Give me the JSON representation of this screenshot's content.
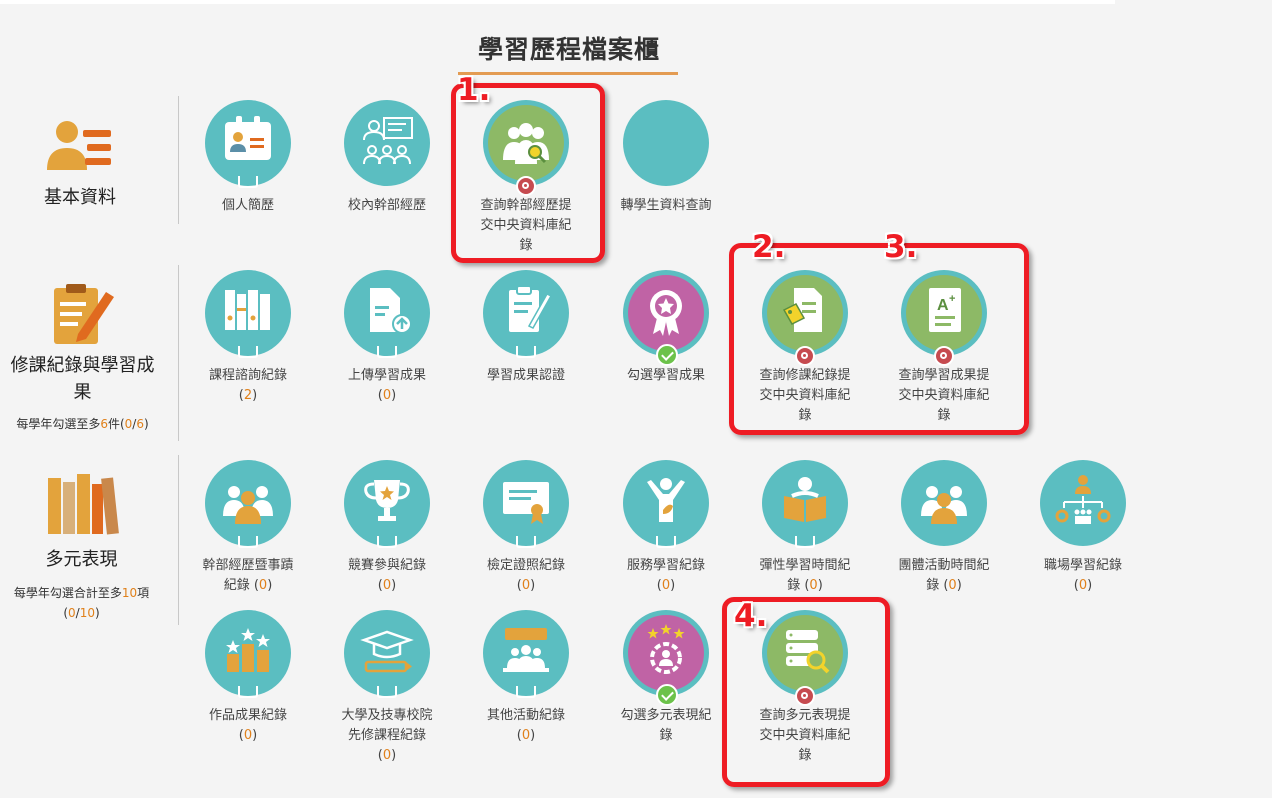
{
  "page": {
    "title": "學習歷程檔案櫃"
  },
  "categories": {
    "basic": {
      "label": "基本資料"
    },
    "course": {
      "label_line1": "修課紀錄與學習成",
      "label_line2": "果",
      "note_prefix": "每學年勾選至多",
      "note_max": "6",
      "note_mid": "件(",
      "note_cur": "0",
      "note_sep": "/",
      "note_max2": "6",
      "note_suffix": ")"
    },
    "multi": {
      "label": "多元表現",
      "note_prefix": "每學年勾選合計至多",
      "note_max": "10",
      "note_suffix": "項",
      "count_open": "(",
      "count_cur": "0",
      "count_sep": "/",
      "count_max": "10",
      "count_close": ")"
    }
  },
  "items": {
    "resume": {
      "label": "個人簡歷"
    },
    "cadre": {
      "label": "校內幹部經歷"
    },
    "cadre_central": {
      "label_l1": "查詢幹部經歷提",
      "label_l2": "交中央資料庫紀",
      "label_l3": "錄"
    },
    "transfer": {
      "label": "轉學生資料查詢"
    },
    "course_consult": {
      "label": "課程諮詢紀錄",
      "count": "2"
    },
    "upload_result": {
      "label": "上傳學習成果",
      "count": "0"
    },
    "result_cert": {
      "label": "學習成果認證"
    },
    "select_result": {
      "label": "勾選學習成果"
    },
    "course_central": {
      "label_l1": "查詢修課紀錄提",
      "label_l2": "交中央資料庫紀",
      "label_l3": "錄"
    },
    "result_central": {
      "label_l1": "查詢學習成果提",
      "label_l2": "交中央資料庫紀",
      "label_l3": "錄"
    },
    "cadre_record": {
      "label_l1": "幹部經歷暨事蹟",
      "label_l2": "紀錄 ",
      "count": "0"
    },
    "competition": {
      "label": "競賽參與紀錄",
      "count": "0"
    },
    "license": {
      "label": "檢定證照紀錄",
      "count": "0"
    },
    "service": {
      "label": "服務學習紀錄",
      "count": "0"
    },
    "flex_time": {
      "label_l1": "彈性學習時間紀",
      "label_l2": "錄 ",
      "count": "0"
    },
    "group_time": {
      "label_l1": "團體活動時間紀",
      "label_l2": "錄 ",
      "count": "0"
    },
    "workplace": {
      "label": "職場學習紀錄",
      "count": "0"
    },
    "works": {
      "label": "作品成果紀錄",
      "count": "0"
    },
    "univ_course": {
      "label_l1": "大學及技專校院",
      "label_l2": "先修課程紀錄",
      "count": "0"
    },
    "other_activity": {
      "label": "其他活動紀錄",
      "count": "0"
    },
    "select_multi": {
      "label_l1": "勾選多元表現紀",
      "label_l2": "錄"
    },
    "multi_central": {
      "label_l1": "查詢多元表現提",
      "label_l2": "交中央資料庫紀",
      "label_l3": "錄"
    }
  },
  "markers": {
    "m1": "1.",
    "m2": "2.",
    "m3": "3.",
    "m4": "4."
  },
  "colors": {
    "teal": "#5bbec1",
    "green": "#8db966",
    "pink": "#c063a5",
    "orange": "#e39b52",
    "red_marker": "#ee1c24"
  }
}
